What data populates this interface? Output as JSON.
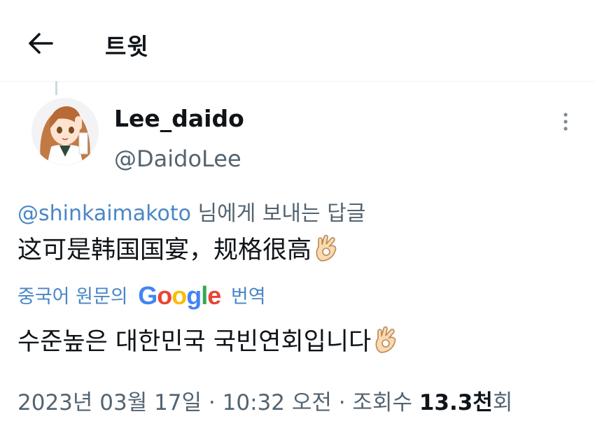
{
  "header": {
    "title": "트윗"
  },
  "author": {
    "name": "Lee_daido",
    "handle": "@DaidoLee"
  },
  "reply": {
    "mention": "@shinkaimakoto",
    "suffix": " 님에게 보내는 답글"
  },
  "tweet": {
    "text": "这可是韩国国宴，规格很高"
  },
  "translation": {
    "prefix": "중국어 원문의",
    "google": [
      "G",
      "o",
      "o",
      "g",
      "l",
      "e"
    ],
    "suffix": "번역",
    "text": "수준높은 대한민국 국빈연회입니다"
  },
  "meta": {
    "date": "2023년 03월 17일",
    "sep": " · ",
    "time": "10:32 오전",
    "views_label": "조회수 ",
    "views_value": "13.3천",
    "views_unit": "회"
  },
  "colors": {
    "accent": "#4a86c5",
    "secondary": "#536471",
    "text": "#0f1419",
    "google": [
      "#4285F4",
      "#EA4335",
      "#FBBC05",
      "#4285F4",
      "#34A853",
      "#EA4335"
    ]
  },
  "icons": {
    "back": "arrow-left-icon",
    "more": "more-vertical-icon",
    "emoji": "ok-hand-emoji-icon"
  }
}
